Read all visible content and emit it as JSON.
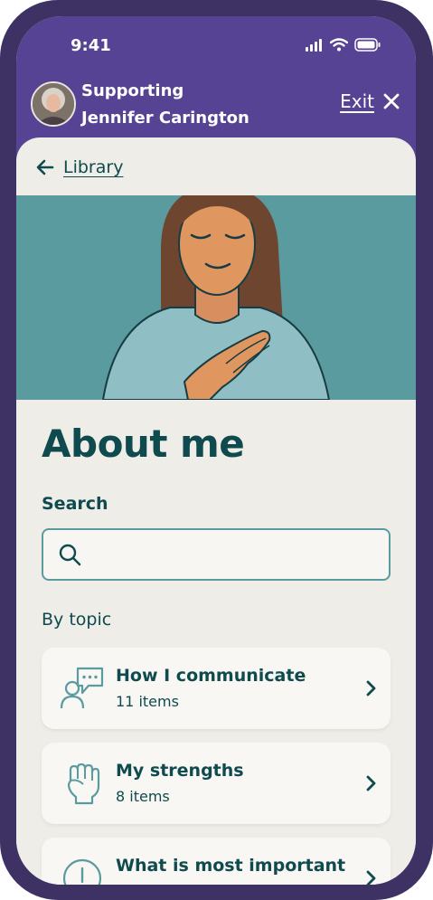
{
  "status_bar": {
    "time": "9:41"
  },
  "header": {
    "supporting_line1": "Supporting",
    "supporting_line2": "Jennifer Carington",
    "exit_label": "Exit"
  },
  "nav": {
    "back_label": "Library"
  },
  "page": {
    "title": "About me",
    "search_label": "Search",
    "search_value": "",
    "by_topic_label": "By topic"
  },
  "topics": [
    {
      "title": "How I communicate",
      "count": "11 items",
      "icon": "communicate-icon"
    },
    {
      "title": "My strengths",
      "count": "8 items",
      "icon": "raised-fist-icon"
    },
    {
      "title": "What is most important",
      "count": "",
      "icon": "info-alert-icon"
    }
  ],
  "colors": {
    "frame": "#3e3264",
    "header_purple": "#574393",
    "hero_teal": "#5a9b9f",
    "text_dark_teal": "#0f4a4e",
    "background": "#efede8"
  }
}
